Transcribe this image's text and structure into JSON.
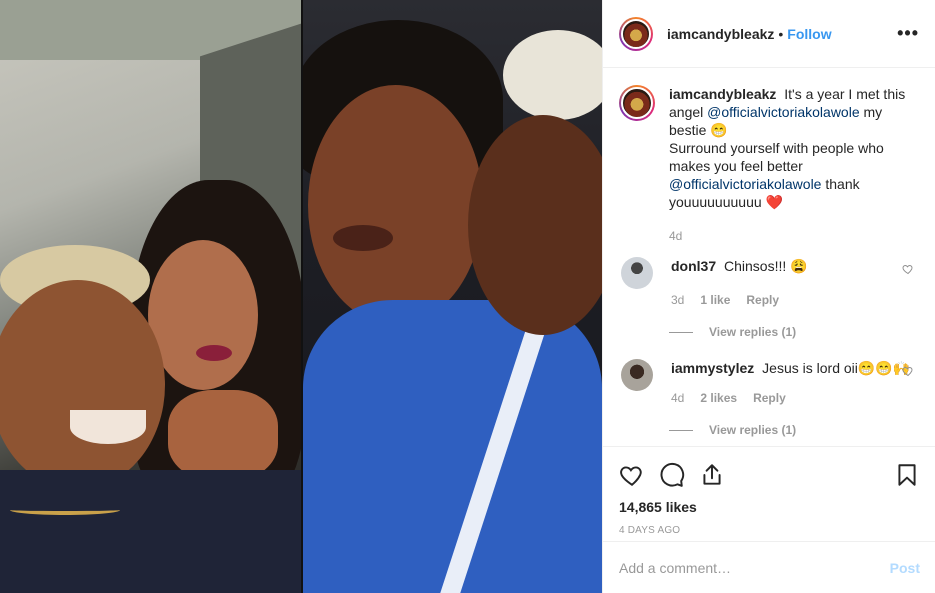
{
  "post": {
    "username": "iamcandybleakz",
    "follow_label": "Follow",
    "more_label": "•••",
    "caption_parts": {
      "p1": "It's a year I met this angel",
      "mention1": "@officialvictoriakolawole",
      "p2": "my bestie 😁",
      "p3": "Surround yourself with people who makes you feel better",
      "mention2": "@officialvictoriakolawole",
      "p4": "thank youuuuuuuuuu ❤️"
    },
    "caption_age": "4d",
    "likes": "14,865 likes",
    "posted": "4 DAYS AGO"
  },
  "comments": [
    {
      "user": "donl37",
      "text": "Chinsos!!! 😩",
      "age": "3d",
      "likes": "1 like",
      "reply": "Reply",
      "view_replies": "View replies (1)"
    },
    {
      "user": "iammystylez",
      "text": "Jesus is lord oii😁😁🙌",
      "age": "4d",
      "likes": "2 likes",
      "reply": "Reply",
      "view_replies": "View replies (1)"
    }
  ],
  "composer": {
    "placeholder": "Add a comment…",
    "post_label": "Post"
  },
  "icons": [
    "heart-icon",
    "comment-icon",
    "share-icon",
    "bookmark-icon",
    "small-heart-icon"
  ]
}
